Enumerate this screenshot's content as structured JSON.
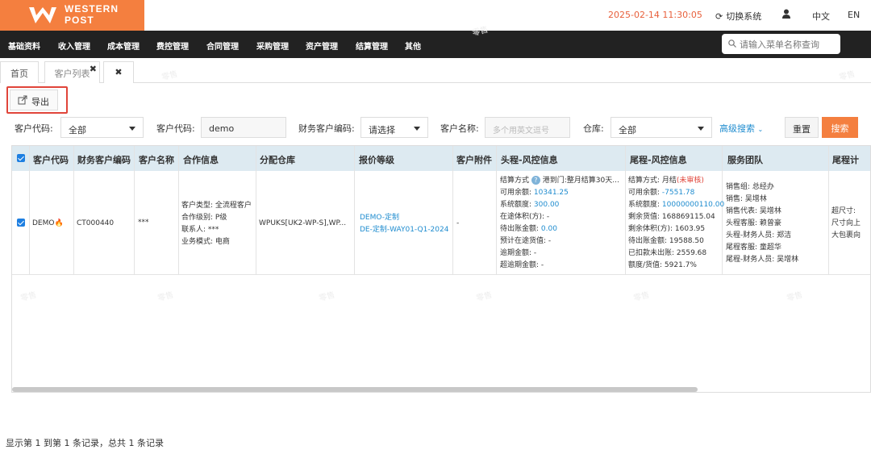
{
  "brand": {
    "line1": "WESTERN",
    "line2": "POST",
    "color": "#f47f3f"
  },
  "header": {
    "datetime": "2025-02-14 11:30:05",
    "switch_label": "切换系统",
    "lang_cn": "中文",
    "lang_en": "EN"
  },
  "nav": {
    "items": [
      "基础资料",
      "收入管理",
      "成本管理",
      "费控管理",
      "合同管理",
      "采购管理",
      "资产管理",
      "结算管理",
      "其他"
    ],
    "search_placeholder": "请输入菜单名称查询"
  },
  "tabs": [
    {
      "label": "首页"
    },
    {
      "label": "客户列表"
    },
    {
      "label": "✖"
    }
  ],
  "toolbar": {
    "export_label": "导出"
  },
  "filters": {
    "customer_code_label": "客户代码:",
    "customer_code_value": "全部",
    "customer_code2_label": "客户代码:",
    "customer_code2_value": "demo",
    "finance_code_label": "财务客户编码:",
    "finance_code_value": "请选择",
    "customer_name_label": "客户名称:",
    "customer_name_placeholder": "多个用英文逗号",
    "warehouse_label": "仓库:",
    "warehouse_value": "全部",
    "advanced_label": "高级搜索",
    "reset_label": "重置",
    "search_label": "搜索"
  },
  "table": {
    "columns": [
      "客户代码",
      "财务客户编码",
      "客户名称",
      "合作信息",
      "分配仓库",
      "报价等级",
      "客户附件",
      "头程-风控信息",
      "尾程-风控信息",
      "服务团队",
      "尾程计"
    ],
    "row": {
      "customer_code": "DEMO",
      "finance_code": "CT000440",
      "customer_name": "***",
      "coop": [
        "客户类型: 全流程客户",
        "合作级别: P级",
        "联系人: ***",
        "业务模式: 电商"
      ],
      "warehouse": "WPUKS[UK2-WP-S],WP...",
      "quote1": "DEMO-定制",
      "quote2": "DE-定制-WAY01-Q1-2024",
      "attachment": "-",
      "head": {
        "settle_label": "结算方式",
        "settle_value": "港到门:整月结算30天...",
        "avail_label": "可用余额:",
        "avail_value": "10341.25",
        "sys_label": "系统额度:",
        "sys_value": "300.00",
        "transit_vol": "在途体积(方): -",
        "unsettled_label": "待出账金额:",
        "unsettled_value": "0.00",
        "est_transit": "预计在途货值: -",
        "overdue": "逾期金额: -",
        "over_overdue": "超逾期金额: -"
      },
      "tail": {
        "settle": "结算方式: 月结",
        "settle_status": "(未审核)",
        "avail_label": "可用余额:",
        "avail_value": "-7551.78",
        "sys_label": "系统额度:",
        "sys_value": "10000000110.00",
        "remain_value": "剩余货值: 168869115.04",
        "remain_vol": "剩余体积(方): 1603.95",
        "unsettled": "待出账金额: 19588.50",
        "deducted": "已扣款未出账: 2559.68",
        "ratio": "额度/货值: 5921.7%"
      },
      "team": [
        "销售组: 总经办",
        "销售: 吴增林",
        "销售代表: 吴增林",
        "头程客服: 赖曾豪",
        "头程-财务人员: 郑洁",
        "尾程客服: 童超华",
        "尾程-财务人员: 吴增林"
      ],
      "tail_calc": [
        "超尺寸:",
        "尺寸向上",
        "大包裹向"
      ]
    }
  },
  "footer": {
    "summary": "显示第 1 到第 1 条记录，总共 1 条记录"
  },
  "watermark": "零售"
}
